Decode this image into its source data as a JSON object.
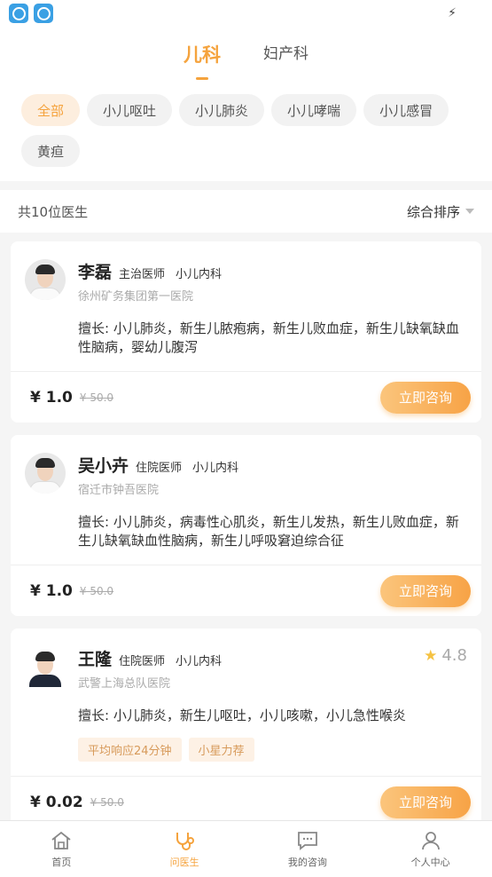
{
  "tabs": [
    {
      "label": "儿科",
      "active": true
    },
    {
      "label": "妇产科",
      "active": false
    }
  ],
  "filters": [
    {
      "label": "全部",
      "active": true
    },
    {
      "label": "小儿呕吐",
      "active": false
    },
    {
      "label": "小儿肺炎",
      "active": false
    },
    {
      "label": "小儿哮喘",
      "active": false
    },
    {
      "label": "小儿感冒",
      "active": false
    },
    {
      "label": "黄疸",
      "active": false
    }
  ],
  "summary": {
    "count_text": "共10位医生",
    "sort_label": "综合排序"
  },
  "doctors": [
    {
      "name": "李磊",
      "title": "主治医师",
      "dept": "小儿内科",
      "hospital": "徐州矿务集团第一医院",
      "skills": "擅长: 小儿肺炎，新生儿脓疱病，新生儿败血症，新生儿缺氧缺血性脑病，婴幼儿腹泻",
      "price": "¥ 1.0",
      "old_price": "¥ 50.0",
      "consult_label": "立即咨询"
    },
    {
      "name": "吴小卉",
      "title": "住院医师",
      "dept": "小儿内科",
      "hospital": "宿迁市钟吾医院",
      "skills": "擅长: 小儿肺炎，病毒性心肌炎，新生儿发热，新生儿败血症，新生儿缺氧缺血性脑病，新生儿呼吸窘迫综合征",
      "price": "¥ 1.0",
      "old_price": "¥ 50.0",
      "consult_label": "立即咨询"
    },
    {
      "name": "王隆",
      "title": "住院医师",
      "dept": "小儿内科",
      "hospital": "武警上海总队医院",
      "rating": "4.8",
      "skills": "擅长: 小儿肺炎，新生儿呕吐，小儿咳嗽，小儿急性喉炎",
      "tags": [
        "平均响应24分钟",
        "小星力荐"
      ],
      "price": "¥ 0.02",
      "old_price": "¥ 50.0",
      "consult_label": "立即咨询"
    }
  ],
  "bottom_nav": [
    {
      "label": "首页",
      "icon": "home-icon",
      "active": false
    },
    {
      "label": "问医生",
      "icon": "stethoscope-icon",
      "active": true
    },
    {
      "label": "我的咨询",
      "icon": "chat-icon",
      "active": false
    },
    {
      "label": "个人中心",
      "icon": "person-icon",
      "active": false
    }
  ],
  "colors": {
    "accent": "#f5a33d",
    "star": "#f5c242",
    "app_icon": "#3aa0e4"
  }
}
